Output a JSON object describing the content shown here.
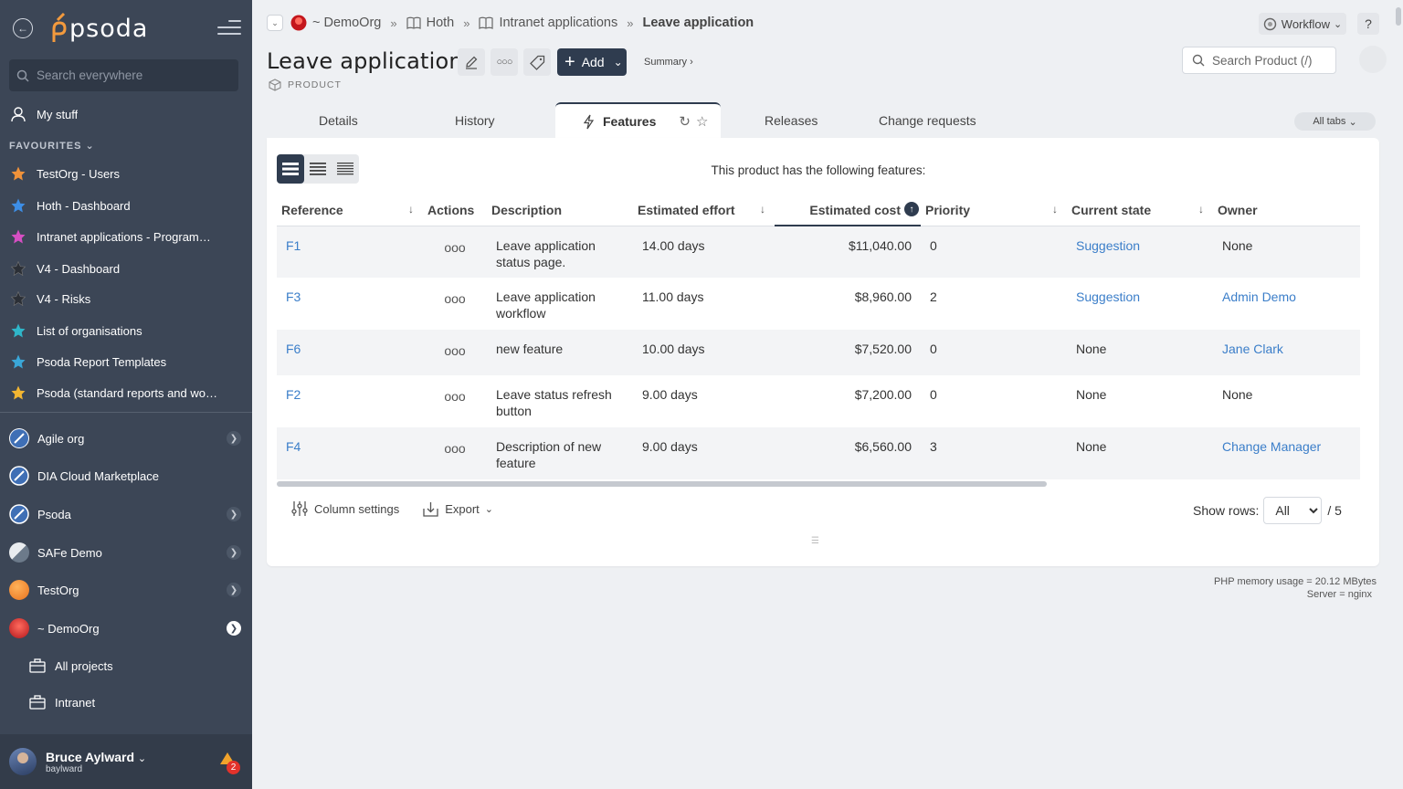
{
  "sidebar": {
    "logo_text": "psoda",
    "search_placeholder": "Search everywhere",
    "my_stuff": "My stuff",
    "favourites_heading": "FAVOURITES",
    "favourites": [
      {
        "label": "TestOrg - Users",
        "color": "#f0923a"
      },
      {
        "label": "Hoth - Dashboard",
        "color": "#3d8ee6"
      },
      {
        "label": "Intranet applications - Programme...",
        "color": "#d64fc3"
      },
      {
        "label": "V4 - Dashboard",
        "color": "#2b2f36"
      },
      {
        "label": "V4 - Risks",
        "color": "#2b2f36"
      },
      {
        "label": "List of organisations",
        "color": "#2fb6c9"
      },
      {
        "label": "Psoda Report Templates",
        "color": "#3aa7d8"
      },
      {
        "label": "Psoda (standard reports and work...",
        "color": "#f2b632"
      }
    ],
    "orgs": [
      {
        "label": "Agile org"
      },
      {
        "label": "DIA Cloud Marketplace"
      },
      {
        "label": "Psoda"
      },
      {
        "label": "SAFe Demo"
      },
      {
        "label": "TestOrg"
      },
      {
        "label": "~ DemoOrg"
      }
    ],
    "sub_items": [
      {
        "label": "All projects"
      },
      {
        "label": "Intranet"
      }
    ],
    "user": {
      "name": "Bruce Aylward",
      "login": "baylward",
      "notifications": "2"
    }
  },
  "breadcrumbs": [
    {
      "label": "~ DemoOrg"
    },
    {
      "label": "Hoth"
    },
    {
      "label": "Intranet applications"
    },
    {
      "label": "Leave application"
    }
  ],
  "header": {
    "title": "Leave application",
    "type_label": "PRODUCT",
    "add_label": "Add",
    "summary_label": "Summary ›",
    "workflow_label": "Workflow",
    "help_label": "?",
    "search_placeholder": "Search Product (/)"
  },
  "tabs": {
    "details": "Details",
    "history": "History",
    "features": "Features",
    "releases": "Releases",
    "change_requests": "Change requests",
    "all_tabs": "All tabs"
  },
  "features": {
    "intro": "This product has the following features:",
    "columns": {
      "reference": "Reference",
      "actions": "Actions",
      "description": "Description",
      "effort": "Estimated effort",
      "cost": "Estimated cost",
      "priority": "Priority",
      "state": "Current state",
      "owner": "Owner"
    },
    "rows": [
      {
        "ref": "F1",
        "actions": "ooo",
        "desc": "Leave application status page.",
        "effort": "14.00 days",
        "cost": "$11,040.00",
        "priority": "0",
        "state": "Suggestion",
        "owner": "None"
      },
      {
        "ref": "F3",
        "actions": "ooo",
        "desc": "Leave application workflow",
        "effort": "11.00 days",
        "cost": "$8,960.00",
        "priority": "2",
        "state": "Suggestion",
        "owner": "Admin Demo"
      },
      {
        "ref": "F6",
        "actions": "ooo",
        "desc": "new feature",
        "effort": "10.00 days",
        "cost": "$7,520.00",
        "priority": "0",
        "state": "None",
        "owner": "Jane Clark"
      },
      {
        "ref": "F2",
        "actions": "ooo",
        "desc": "Leave status refresh button",
        "effort": "9.00 days",
        "cost": "$7,200.00",
        "priority": "0",
        "state": "None",
        "owner": "None"
      },
      {
        "ref": "F4",
        "actions": "ooo",
        "desc": "Description of new feature",
        "effort": "9.00 days",
        "cost": "$6,560.00",
        "priority": "3",
        "state": "None",
        "owner": "Change Manager"
      }
    ],
    "column_settings": "Column settings",
    "export": "Export",
    "show_rows_label": "Show rows:",
    "show_rows_value": "All",
    "total": "/ 5"
  },
  "footer": {
    "memory": "PHP memory usage = 20.12 MBytes",
    "server": "Server = nginx"
  },
  "colors": {
    "sidebar": "#3c4656",
    "accent": "#2f3c4f",
    "link": "#3b7ec9"
  }
}
